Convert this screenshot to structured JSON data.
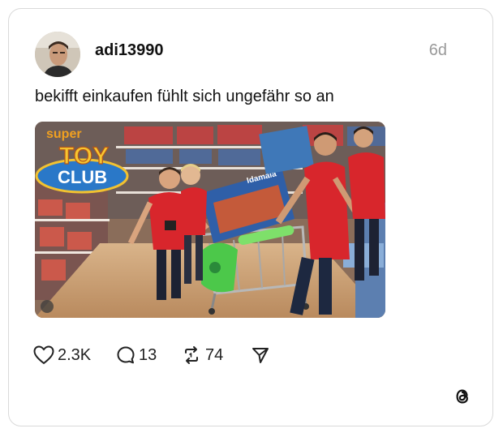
{
  "post": {
    "username": "adi13990",
    "timestamp": "6d",
    "text": "bekifft einkaufen fühlt sich ungefähr so an"
  },
  "media": {
    "logo_line1": "super",
    "logo_line2": "TOY",
    "logo_line3": "CLUB",
    "box_label": "Idamala"
  },
  "actions": {
    "likes": "2.3K",
    "replies": "13",
    "reposts": "74"
  },
  "icons": {
    "like": "heart-icon",
    "reply": "comment-icon",
    "repost": "repost-icon",
    "share": "send-icon",
    "brand": "threads-logo-icon"
  },
  "colors": {
    "muted_text": "#999999",
    "border": "#d9d9d9",
    "shirt_red": "#d8262c"
  }
}
